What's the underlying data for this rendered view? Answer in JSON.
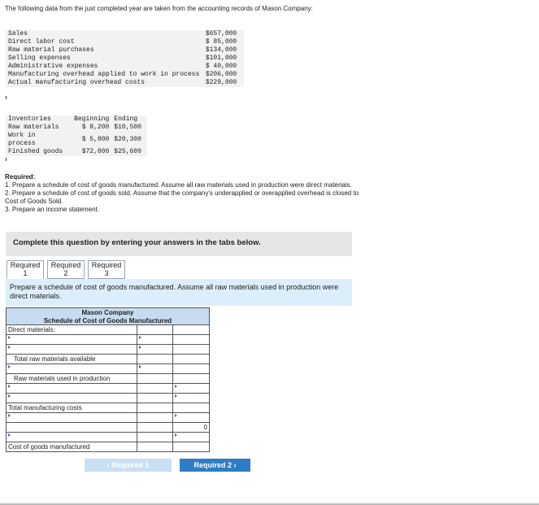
{
  "intro": "The following data from the just completed year are taken from the accounting records of Mason Company:",
  "data_rows": [
    {
      "label": "Sales",
      "value": "$657,000"
    },
    {
      "label": "Direct labor cost",
      "value": "$ 85,000"
    },
    {
      "label": "Raw material purchases",
      "value": "$134,000"
    },
    {
      "label": "Selling expenses",
      "value": "$101,000"
    },
    {
      "label": "Administrative expenses",
      "value": "$ 40,000"
    },
    {
      "label": "Manufacturing overhead applied to work in process",
      "value": "$206,000"
    },
    {
      "label": "Actual manufacturing overhead costs",
      "value": "$229,000"
    }
  ],
  "inventories": {
    "header": {
      "label": "Inventories",
      "beginning": "Beginning",
      "ending": "Ending"
    },
    "rows": [
      {
        "label": "Raw materials",
        "beginning": "$ 8,200",
        "ending": "$10,500"
      },
      {
        "label": "Work in process",
        "beginning": "$ 5,800",
        "ending": "$20,300"
      },
      {
        "label": "Finished goods",
        "beginning": "$72,000",
        "ending": "$25,600"
      }
    ]
  },
  "required": {
    "heading": "Required:",
    "items": [
      "1. Prepare a schedule of cost of goods manufactured. Assume all raw materials used in production were direct materials.",
      "2. Prepare a schedule of cost of goods sold. Assume that the company's underapplied or overapplied overhead is closed to Cost of Goods Sold.",
      "3. Prepare an income statement."
    ]
  },
  "banner": "Complete this question by entering your answers in the tabs below.",
  "tabs": [
    {
      "line1": "Required",
      "line2": "1"
    },
    {
      "line1": "Required",
      "line2": "2"
    },
    {
      "line1": "Required",
      "line2": "3"
    }
  ],
  "instruction": "Prepare a schedule of cost of goods manufactured. Assume all raw materials used in production were direct materials.",
  "schedule": {
    "company": "Mason Company",
    "title": "Schedule of Cost of Goods Manufactured",
    "direct_materials": "Direct materials:",
    "total_raw": "Total raw materials available",
    "raw_used": "Raw materials used in production",
    "total_mfg": "Total manufacturing costs",
    "cogm": "Cost of goods manufactured",
    "zero_value": "0"
  },
  "nav": {
    "prev_label": "Required 1",
    "next_label": "Required 2",
    "prev_icon": "chevron-left-icon",
    "next_icon": "chevron-right-icon"
  },
  "colors": {
    "accent": "#2f7dc4",
    "header_bg": "#c7dcf0",
    "instruction_bg": "#dceefa"
  }
}
